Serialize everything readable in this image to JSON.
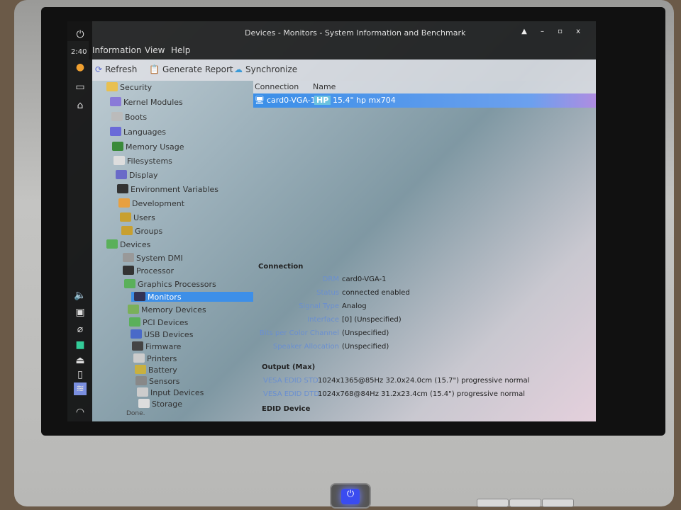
{
  "window": {
    "title": "Devices - Monitors - System Information and Benchmark",
    "controls": "▲ – ▫ x"
  },
  "dock": {
    "clock": "2:40"
  },
  "menu": [
    "Information",
    "View",
    "Help"
  ],
  "toolbar": {
    "refresh": "Refresh",
    "report": "Generate Report",
    "sync": "Synchronize"
  },
  "sidebar": {
    "items": [
      "Security",
      "Kernel Modules",
      "Boots",
      "Languages",
      "Memory Usage",
      "Filesystems",
      "Display",
      "Environment Variables",
      "Development",
      "Users",
      "Groups",
      "Devices",
      "System DMI",
      "Processor",
      "Graphics Processors",
      "Monitors",
      "Memory Devices",
      "PCI Devices",
      "USB Devices",
      "Firmware",
      "Printers",
      "Battery",
      "Sensors",
      "Input Devices",
      "Storage"
    ],
    "selected": "Monitors"
  },
  "status": "Done.",
  "list": {
    "columns": [
      "Connection",
      "Name"
    ],
    "rows": [
      {
        "connection": "card0-VGA-1",
        "vendor": "HP",
        "name": "15.4\" hp mx704"
      }
    ]
  },
  "details": {
    "connection_title": "Connection",
    "connection": [
      {
        "k": "DRM",
        "v": "card0-VGA-1"
      },
      {
        "k": "Status",
        "v": "connected enabled"
      },
      {
        "k": "Signal Type",
        "v": "Analog"
      },
      {
        "k": "Interface",
        "v": "[0] (Unspecified)"
      },
      {
        "k": "Bits per Color Channel",
        "v": "(Unspecified)"
      },
      {
        "k": "Speaker Allocation",
        "v": "(Unspecified)"
      }
    ],
    "output_title": "Output (Max)",
    "output": [
      {
        "k": "VESA EDID STD",
        "v": "1024x1365@85Hz 32.0x24.0cm (15.7\") progressive normal"
      },
      {
        "k": "VESA EDID DTD",
        "v": "1024x768@84Hz 31.2x23.4cm (15.4\") progressive normal"
      }
    ],
    "edid_title": "EDID Device"
  },
  "colors": {
    "selection": "#3d8fe8",
    "key_label": "#6a8fd0",
    "power_led": "#3a4cf0"
  }
}
